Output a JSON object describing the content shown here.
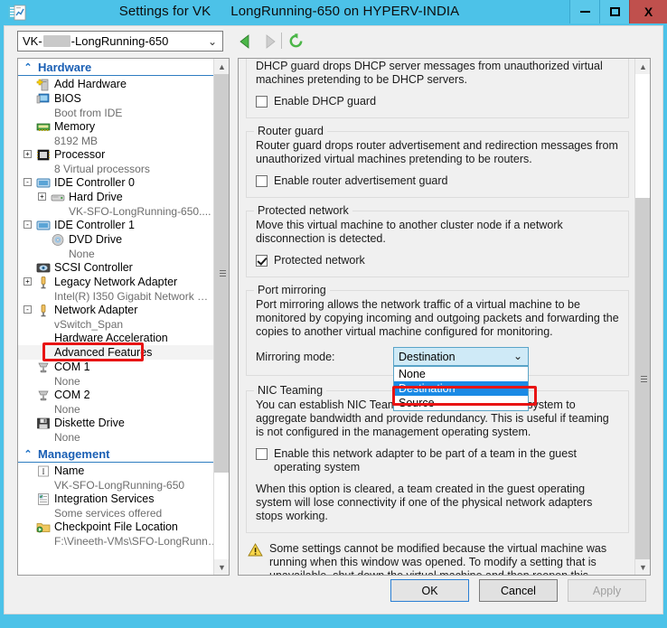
{
  "window": {
    "title_part1": "Settings for VK",
    "title_part2": "LongRunning-650 on HYPERV-INDIA",
    "icon": "settings-document-icon",
    "minimize_label": "Minimize",
    "maximize_label": "Maximize",
    "close_label": "X"
  },
  "toolbar": {
    "vm_name_prefix": "VK-",
    "vm_name_suffix": "-LongRunning-650",
    "dropdown_arrow": "⌄",
    "back_label": "Back",
    "forward_label": "Forward",
    "refresh_label": "Refresh"
  },
  "tree": {
    "hardware_group": "Hardware",
    "management_group": "Management",
    "chevron": "⌃",
    "items": [
      {
        "label": "Add Hardware",
        "icon": "add-hardware-icon",
        "sub": null,
        "expander": null,
        "indent": 20
      },
      {
        "label": "BIOS",
        "icon": "bios-icon",
        "sub": "Boot from IDE",
        "expander": null,
        "indent": 20
      },
      {
        "label": "Memory",
        "icon": "memory-icon",
        "sub": "8192 MB",
        "expander": null,
        "indent": 20
      },
      {
        "label": "Processor",
        "icon": "processor-icon",
        "sub": "8 Virtual processors",
        "expander": "+",
        "indent": 20
      },
      {
        "label": "IDE Controller 0",
        "icon": "ide-controller-icon",
        "sub": null,
        "expander": "-",
        "indent": 20
      },
      {
        "label": "Hard Drive",
        "icon": "hard-drive-icon",
        "sub": "VK-SFO-LongRunning-650....",
        "expander": "+",
        "indent": 36
      },
      {
        "label": "IDE Controller 1",
        "icon": "ide-controller-icon",
        "sub": null,
        "expander": "-",
        "indent": 20
      },
      {
        "label": "DVD Drive",
        "icon": "dvd-drive-icon",
        "sub": "None",
        "expander": null,
        "indent": 36
      },
      {
        "label": "SCSI Controller",
        "icon": "scsi-controller-icon",
        "sub": null,
        "expander": null,
        "indent": 20
      },
      {
        "label": "Legacy Network Adapter",
        "icon": "network-adapter-icon",
        "sub": "Intel(R) I350 Gigabit Network …",
        "expander": "+",
        "indent": 20
      },
      {
        "label": "Network Adapter",
        "icon": "network-adapter-icon",
        "sub": "vSwitch_Span",
        "expander": "-",
        "indent": 20
      },
      {
        "label": "Hardware Acceleration",
        "icon": null,
        "sub": null,
        "expander": null,
        "indent": 40
      },
      {
        "label": "Advanced Features",
        "icon": null,
        "sub": null,
        "expander": null,
        "indent": 40,
        "selected": true,
        "annotated": true
      },
      {
        "label": "COM 1",
        "icon": "com-port-icon",
        "sub": "None",
        "expander": null,
        "indent": 20
      },
      {
        "label": "COM 2",
        "icon": "com-port-icon",
        "sub": "None",
        "expander": null,
        "indent": 20
      },
      {
        "label": "Diskette Drive",
        "icon": "diskette-drive-icon",
        "sub": "None",
        "expander": null,
        "indent": 20
      }
    ],
    "management_items": [
      {
        "label": "Name",
        "icon": "name-icon",
        "sub": "VK-SFO-LongRunning-650",
        "indent": 20
      },
      {
        "label": "Integration Services",
        "icon": "integration-services-icon",
        "sub": "Some services offered",
        "indent": 20
      },
      {
        "label": "Checkpoint File Location",
        "icon": "checkpoint-folder-icon",
        "sub": "F:\\Vineeth-VMs\\SFO-LongRunn…",
        "indent": 20
      }
    ]
  },
  "content": {
    "dhcp_guard": {
      "description": "DHCP guard drops DHCP server messages from unauthorized virtual machines pretending to be DHCP servers.",
      "checkbox_label": "Enable DHCP guard",
      "checked": false
    },
    "router_guard": {
      "title": "Router guard",
      "description": "Router guard drops router advertisement and redirection messages from unauthorized virtual machines pretending to be routers.",
      "checkbox_label": "Enable router advertisement guard",
      "checked": false
    },
    "protected_network": {
      "title": "Protected network",
      "description": "Move this virtual machine to another cluster node if a network disconnection is detected.",
      "checkbox_label": "Protected network",
      "checked": true
    },
    "port_mirroring": {
      "title": "Port mirroring",
      "description": "Port mirroring allows the network traffic of a virtual machine to be monitored by copying incoming and outgoing packets and forwarding the copies to another virtual machine configured for monitoring.",
      "mirroring_mode_label": "Mirroring mode:",
      "selected_value": "Destination",
      "options": [
        "None",
        "Destination",
        "Source"
      ],
      "dropdown_open": true
    },
    "nic_teaming": {
      "title": "NIC Teaming",
      "description": "You can establish NIC Teaming in the guest operating system to aggregate bandwidth and provide redundancy. This is useful if teaming is not configured in the management operating system.",
      "checkbox_label": "Enable this network adapter to be part of a team in the guest operating system",
      "checked": false,
      "note": "When this option is cleared, a team created in the guest operating system will lose connectivity if one of the physical network adapters stops working."
    },
    "warning": {
      "icon": "warning-triangle-icon",
      "text": "Some settings cannot be modified because the virtual machine was running when this window was opened. To modify a setting that is unavailable, shut down the virtual machine and then reopen this window."
    }
  },
  "footer": {
    "ok": "OK",
    "cancel": "Cancel",
    "apply": "Apply"
  },
  "colors": {
    "titlebar": "#4cc2e8",
    "close_button": "#c0504d",
    "annotation": "#e81414",
    "selection": "#1a8ae5",
    "group_header_text": "#1a5fb4"
  }
}
